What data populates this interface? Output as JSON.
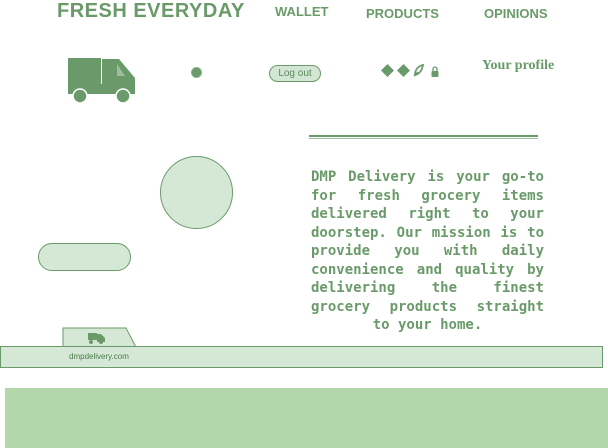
{
  "header": {
    "brand": "FRESH EVERYDAY",
    "nav": [
      {
        "label": "WALLET"
      },
      {
        "label": "PRODUCTS"
      },
      {
        "label": "OPINIONS"
      }
    ]
  },
  "toolbar": {
    "logout_label": "Log out",
    "profile_label": "Your profile",
    "icons": [
      "diamond-icon",
      "diamond-icon",
      "leaf-icon",
      "lock-icon"
    ]
  },
  "main": {
    "description": "DMP Delivery is your go-to for fresh grocery items delivered right to your doorstep. Our mission is to provide you with daily convenience and quality by delivering the finest grocery products straight to your home."
  },
  "footer": {
    "url": "dmpdelivery.com"
  },
  "colors": {
    "accent": "#6a9a6a",
    "light_fill": "#d5e8d5",
    "bottom_block": "#b3d6aa"
  }
}
